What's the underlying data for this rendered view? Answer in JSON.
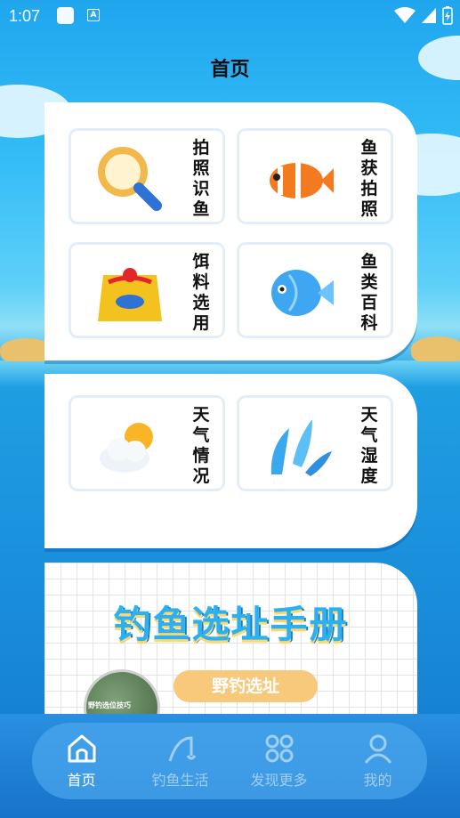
{
  "status_bar": {
    "time": "1:07",
    "notification_letter": "A"
  },
  "page": {
    "title": "首页"
  },
  "grid1": [
    {
      "label": "拍照识鱼",
      "chars": [
        "拍",
        "照",
        "识",
        "鱼"
      ],
      "icon": "magnifier-icon"
    },
    {
      "label": "鱼获拍照",
      "chars": [
        "鱼",
        "获",
        "拍",
        "照"
      ],
      "icon": "clownfish-icon"
    },
    {
      "label": "饵料选用",
      "chars": [
        "饵",
        "料",
        "选",
        "用"
      ],
      "icon": "bait-bag-icon"
    },
    {
      "label": "鱼类百科",
      "chars": [
        "鱼",
        "类",
        "百",
        "科"
      ],
      "icon": "bluefish-icon"
    }
  ],
  "grid2": [
    {
      "label": "天气情况",
      "chars": [
        "天",
        "气",
        "情",
        "况"
      ],
      "icon": "sun-cloud-icon"
    },
    {
      "label": "天气湿度",
      "chars": [
        "天",
        "气",
        "湿",
        "度"
      ],
      "icon": "water-splash-icon"
    }
  ],
  "handbook": {
    "title": "钓鱼选址手册",
    "button_label": "野钓选址",
    "thumb_caption": "野钓选位技巧"
  },
  "nav": [
    {
      "label": "首页",
      "icon": "home-icon",
      "active": true
    },
    {
      "label": "钓鱼生活",
      "icon": "fishing-rod-icon",
      "active": false
    },
    {
      "label": "发现更多",
      "icon": "grid-icon",
      "active": false
    },
    {
      "label": "我的",
      "icon": "user-icon",
      "active": false
    }
  ],
  "colors": {
    "accent": "#2cb0f2",
    "button": "#f9c97b",
    "nav_bg": "#1773c8"
  }
}
